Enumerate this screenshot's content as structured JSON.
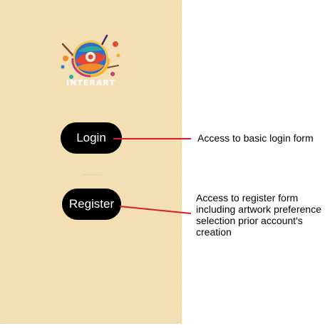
{
  "app": {
    "brand_name": "INTERART"
  },
  "buttons": {
    "login_label": "Login",
    "register_label": "Register"
  },
  "annotations": {
    "login_note": "Access to basic login form",
    "register_note": "Access to register form including artwork preference selection prior account's creation"
  },
  "colors": {
    "screen_background": "#f4deb4",
    "button_background": "#000000",
    "button_text": "#ffffff",
    "annotation_line": "#d21f2a"
  },
  "icons": {
    "logo": "artistic-swirl-logo-icon"
  }
}
